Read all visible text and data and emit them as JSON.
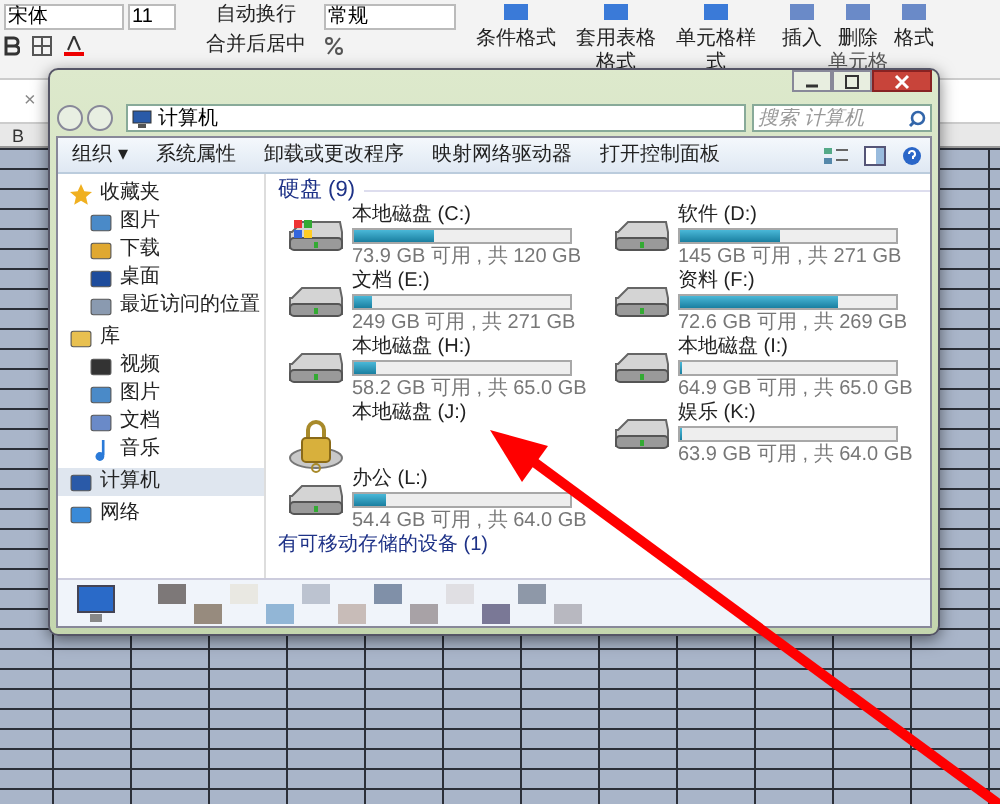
{
  "ribbon": {
    "font_name": "宋体",
    "font_size": "11",
    "wrap_text": "自动换行",
    "merge_center": "合并后居中",
    "number_format": "常规",
    "styles": [
      "条件格式",
      "套用表格格式",
      "单元格样式"
    ],
    "cells": [
      "插入",
      "删除",
      "格式"
    ],
    "group_label": "单元格"
  },
  "formula_bar": {
    "cancel": "×"
  },
  "sheet": {
    "column_header": "B"
  },
  "explorer": {
    "address": [
      "计算机"
    ],
    "search": {
      "placeholder": "搜索 计算机"
    },
    "toolbar": [
      "组织 ▾",
      "系统属性",
      "卸载或更改程序",
      "映射网络驱动器",
      "打开控制面板"
    ],
    "nav": [
      {
        "label": "收藏夹",
        "kind": "star",
        "selected": false,
        "children": [
          {
            "label": "图片",
            "kind": "picture",
            "selected": false
          },
          {
            "label": "下载",
            "kind": "download",
            "selected": false
          },
          {
            "label": "桌面",
            "kind": "desktop",
            "selected": false
          },
          {
            "label": "最近访问的位置",
            "kind": "recent",
            "selected": false
          }
        ]
      },
      {
        "label": "库",
        "kind": "library",
        "selected": false,
        "children": [
          {
            "label": "视频",
            "kind": "video",
            "selected": false
          },
          {
            "label": "图片",
            "kind": "picture",
            "selected": false
          },
          {
            "label": "文档",
            "kind": "document",
            "selected": false
          },
          {
            "label": "音乐",
            "kind": "music",
            "selected": false
          }
        ]
      },
      {
        "label": "计算机",
        "kind": "computer",
        "selected": true
      },
      {
        "label": "网络",
        "kind": "network",
        "selected": false
      }
    ],
    "section": "硬盘 (9)",
    "drives": [
      {
        "name": "本地磁盘 (C:)",
        "kind": "system",
        "level": 0.37,
        "reading": "73.9 GB 可用 , 共 120 GB"
      },
      {
        "name": "软件 (D:)",
        "kind": "disk",
        "level": 0.46,
        "reading": "145 GB 可用 , 共 271 GB"
      },
      {
        "name": "文档 (E:)",
        "kind": "disk",
        "level": 0.08,
        "reading": "249 GB 可用 , 共 271 GB"
      },
      {
        "name": "资料 (F:)",
        "kind": "disk",
        "level": 0.73,
        "reading": "72.6 GB 可用 , 共 269 GB"
      },
      {
        "name": "本地磁盘 (H:)",
        "kind": "disk",
        "level": 0.1,
        "reading": "58.2 GB 可用 , 共 65.0 GB"
      },
      {
        "name": "本地磁盘 (I:)",
        "kind": "disk",
        "level": 0.01,
        "reading": "64.9 GB 可用 , 共 65.0 GB"
      },
      {
        "name": "本地磁盘 (J:)",
        "kind": "locked"
      },
      {
        "name": "娱乐 (K:)",
        "kind": "disk",
        "level": 0.01,
        "reading": "63.9 GB 可用 , 共 64.0 GB"
      },
      {
        "name": "办公 (L:)",
        "kind": "disk",
        "level": 0.15,
        "reading": "54.4 GB 可用 , 共 64.0 GB"
      }
    ],
    "section_2": "有可移动存储的设备 (1)"
  }
}
